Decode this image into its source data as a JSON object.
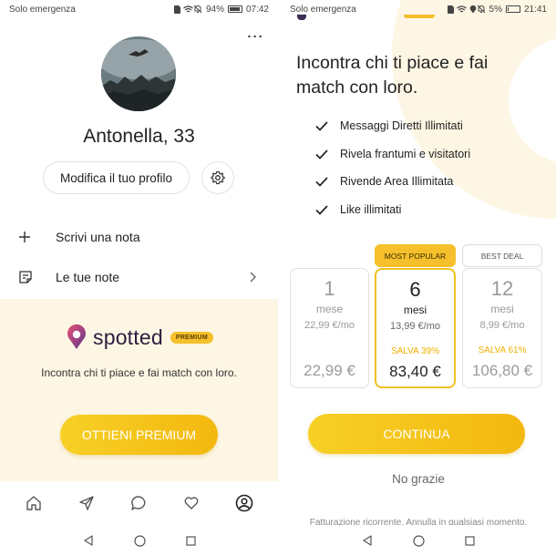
{
  "left": {
    "status": {
      "carrier": "Solo emergenza",
      "battery": "94%",
      "battery_fill": 0.94,
      "time": "07:42"
    },
    "menu_dots": "⋮",
    "profile": {
      "name": "Antonella, 33"
    },
    "edit_profile_label": "Modifica il tuo profilo",
    "menu": [
      {
        "icon": "plus-icon",
        "label": "Scrivi una nota"
      },
      {
        "icon": "notes-icon",
        "label": "Le tue note"
      }
    ],
    "promo": {
      "logo_text": "spotted",
      "badge": "PREMIUM",
      "text": "Incontra chi ti piace e fai match con loro.",
      "button": "OTTIENI PREMIUM"
    },
    "tabbar": [
      "home-icon",
      "send-icon",
      "chat-icon",
      "heart-icon",
      "profile-icon"
    ]
  },
  "right": {
    "status": {
      "carrier": "Solo emergenza",
      "battery": "5%",
      "battery_fill": 0.05,
      "time": "21:41"
    },
    "title": "Incontra chi ti piace e fai match con loro.",
    "features": [
      "Messaggi Diretti Illimitati",
      "Rivela frantumi e visitatori",
      "Rivende Area Illimitata",
      "Like illimitati"
    ],
    "tags": {
      "popular": "MOST POPULAR",
      "best": "BEST DEAL"
    },
    "plans": [
      {
        "num": "1",
        "unit": "mese",
        "per_month": "22,99 €/mo",
        "save": "",
        "total": "22,99 €"
      },
      {
        "num": "6",
        "unit": "mesi",
        "per_month": "13,99 €/mo",
        "save": "SALVA 39%",
        "total": "83,40 €"
      },
      {
        "num": "12",
        "unit": "mesi",
        "per_month": "8,99 €/mo",
        "save": "SALVA 61%",
        "total": "106,80 €"
      }
    ],
    "selected_plan": "6",
    "continue_label": "CONTINUA",
    "no_thanks": "No grazie",
    "billing": "Fatturazione ricorrente. Annulla in qualsiasi momento."
  },
  "colors": {
    "accent": "#f5c02b",
    "accent_dark": "#f0b000",
    "promo_bg": "#fdf6e4",
    "logo_purple": "#5b3a8c",
    "logo_pink": "#e94e77"
  },
  "nav_icons": [
    "back-icon",
    "home-nav-icon",
    "recents-icon"
  ]
}
